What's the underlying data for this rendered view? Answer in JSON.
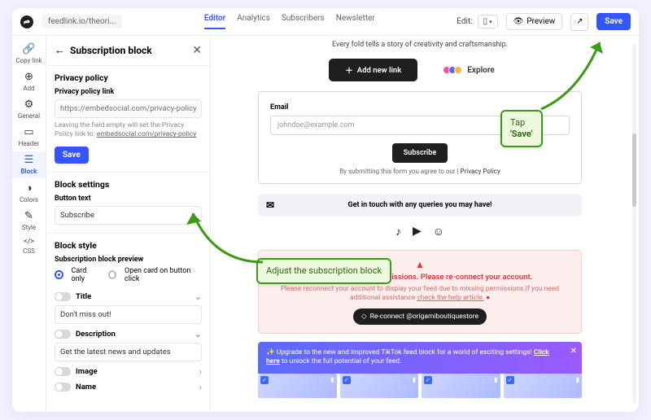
{
  "topbar": {
    "url": "feedlink.io/theori...",
    "tabs": [
      "Editor",
      "Analytics",
      "Subscribers",
      "Newsletter"
    ],
    "active_tab": 0,
    "edit_label": "Edit:",
    "preview_label": "Preview",
    "save_label": "Save"
  },
  "rail": [
    {
      "icon": "🔗",
      "label": "Copy link"
    },
    {
      "icon": "⊕",
      "label": "Add"
    },
    {
      "icon": "⚙",
      "label": "General"
    },
    {
      "icon": "▭",
      "label": "Header"
    },
    {
      "icon": "☰",
      "label": "Block"
    },
    {
      "icon": "◑",
      "label": "Colors"
    },
    {
      "icon": "✎",
      "label": "Style"
    },
    {
      "icon": "</>",
      "label": "CSS"
    }
  ],
  "rail_active": 4,
  "panel": {
    "title": "Subscription block",
    "privacy": {
      "heading": "Privacy policy",
      "label": "Privacy policy link",
      "placeholder": "https://embedsocial.com/privacy-policy",
      "hint_pre": "Leaving the field empty will set the Privacy Policy link to: ",
      "hint_link": "embedsocial.com/privacy-policy",
      "save": "Save"
    },
    "settings": {
      "heading": "Block settings",
      "label": "Button text",
      "value": "Subscribe"
    },
    "style": {
      "heading": "Block style",
      "preview_label": "Subscription block preview",
      "radio_a": "Card only",
      "radio_b": "Open card on button click",
      "title_label": "Title",
      "title_value": "Don't miss out!",
      "desc_label": "Description",
      "desc_value": "Get the latest news and updates",
      "image_label": "Image",
      "name_label": "Name"
    }
  },
  "canvas": {
    "tagline": "Every fold tells a story of creativity and craftsmanship.",
    "add_link": "Add new link",
    "explore": "Explore",
    "email_card": {
      "label": "Email",
      "placeholder": "johndoe@example.com",
      "button": "Subscribe",
      "terms_pre": "By submitting this form you agree to our | ",
      "terms_link": "Privacy Policy"
    },
    "contact": "Get in touch with any queries you may have!",
    "warning": {
      "title": "Missing Instagram permissions. Please re-connect your account.",
      "text": "Please reconnect your account to display your feed due to missing permissions.If you need additional assistance ",
      "help_link": "check the help article.",
      "button": "Re-connect @origamiboutiquestore"
    },
    "tiktok": {
      "text_a": "✨ Upgrade to the new and improved TikTok feed block for a world of exciting settings! ",
      "link": "Click here",
      "text_b": " to unlock the full potential of your feed."
    }
  },
  "annotations": {
    "adjust": "Adjust the subscription block",
    "save_a": "Tap",
    "save_b": "'Save'"
  }
}
